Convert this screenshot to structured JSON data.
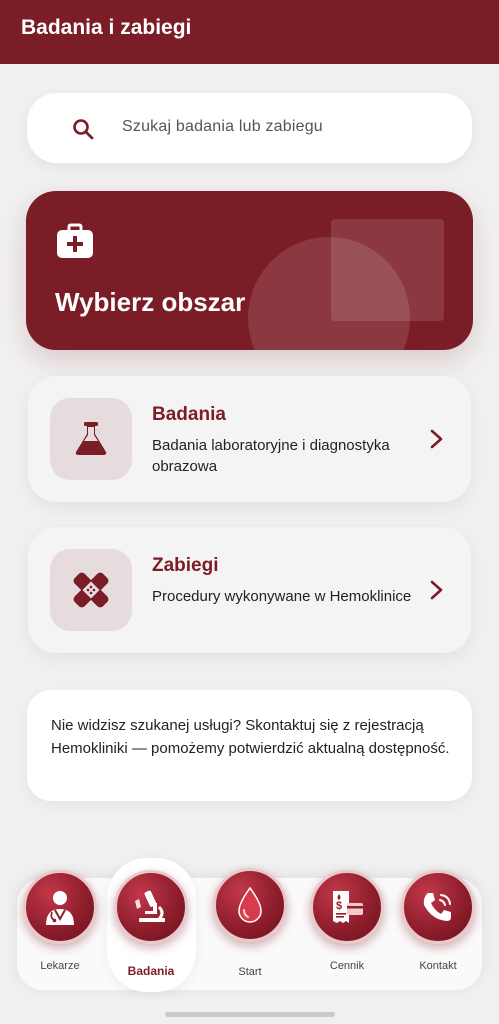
{
  "appbar": {
    "title": "Badania i zabiegi"
  },
  "search": {
    "placeholder": "Szukaj badania lub zabiegu",
    "icon": "search-icon"
  },
  "hero": {
    "title": "Wybierz obszar",
    "icon": "first-aid-kit-icon"
  },
  "cards": [
    {
      "title": "Badania",
      "description": "Badania laboratoryjne i diagnostyka obrazowa",
      "icon": "flask-icon"
    },
    {
      "title": "Zabiegi",
      "description": "Procedury wykonywane w Hemoklinice",
      "icon": "bandage-icon"
    }
  ],
  "info": {
    "text": "Nie widzisz szukanej usługi? Skontaktuj się z rejestracją Hemokliniki — pomożemy potwierdzić aktualną dostępność."
  },
  "nav": {
    "items": [
      {
        "label": "Lekarze",
        "icon": "doctor-icon"
      },
      {
        "label": "Badania",
        "icon": "microscope-icon",
        "active": true
      },
      {
        "label": "Start",
        "icon": "blood-drop-icon"
      },
      {
        "label": "Cennik",
        "icon": "price-list-icon"
      },
      {
        "label": "Kontakt",
        "icon": "phone-icon"
      }
    ]
  },
  "colors": {
    "brand": "#7b1d27",
    "background": "#f1f0f0",
    "tile": "#e7dcdd"
  }
}
